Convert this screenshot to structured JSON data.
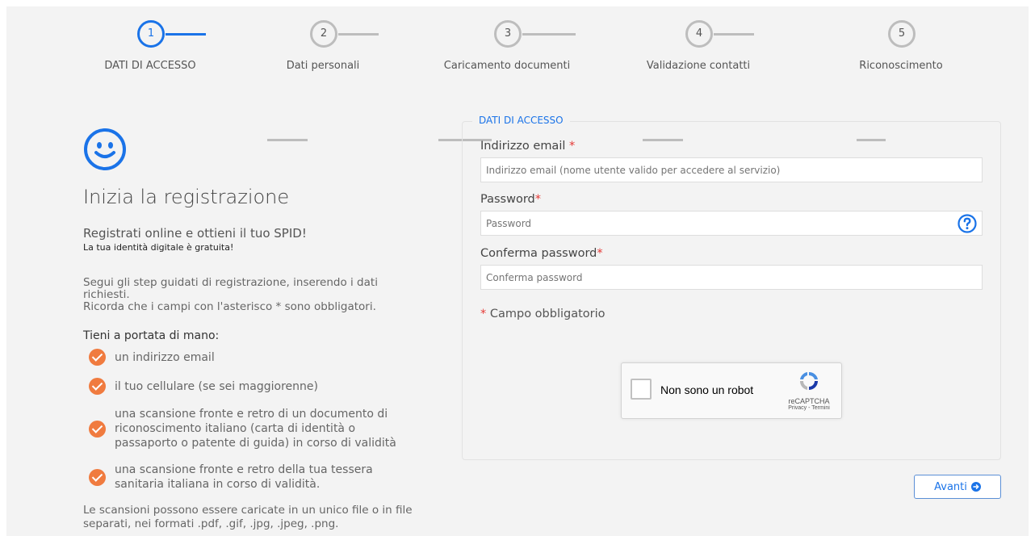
{
  "steps": [
    {
      "number": "1",
      "label": "DATI DI ACCESSO",
      "active": true
    },
    {
      "number": "2",
      "label": "Dati personali",
      "active": false
    },
    {
      "number": "3",
      "label": "Caricamento documenti",
      "active": false
    },
    {
      "number": "4",
      "label": "Validazione contatti",
      "active": false
    },
    {
      "number": "5",
      "label": "Riconoscimento",
      "active": false
    }
  ],
  "intro": {
    "icon": "smiley-icon",
    "title": "Inizia la registrazione",
    "subtitle": "Registrati online e ottieni il tuo SPID!",
    "subtitle_small": "La tua identità digitale è gratuita!",
    "paragraph_1": "Segui gli step guidati di registrazione, inserendo i dati richiesti.",
    "paragraph_2": "Ricorda che i campi con l'asterisco * sono obbligatori.",
    "checklist_title": "Tieni a portata di mano:",
    "checklist": [
      "un indirizzo email",
      "il tuo cellulare (se sei maggiorenne)",
      "una scansione fronte e retro di un documento di riconoscimento italiano (carta di identità o passaporto o patente di guida) in corso di validità",
      "una scansione fronte e retro della tua tessera sanitaria italiana in corso di validità."
    ],
    "footer_note": "Le scansioni possono essere caricate in un unico file o in file separati, nei formati .pdf, .gif, .jpg, .jpeg, .png."
  },
  "form": {
    "legend": "DATI DI ACCESSO",
    "email_label": "Indirizzo email",
    "email_placeholder": "Indirizzo email (nome utente valido per accedere al servizio)",
    "password_label": "Password",
    "password_placeholder": "Password",
    "confirm_label": "Conferma password",
    "confirm_placeholder": "Conferma password",
    "required_marker": "*",
    "mandatory_note": "Campo obbligatorio"
  },
  "captcha": {
    "label": "Non sono un robot",
    "brand": "reCAPTCHA",
    "links": "Privacy - Termini"
  },
  "next_button": "Avanti",
  "colors": {
    "accent": "#1a73e8",
    "check": "#f07b3f",
    "required": "#e53935",
    "background": "#f3f3f3"
  }
}
